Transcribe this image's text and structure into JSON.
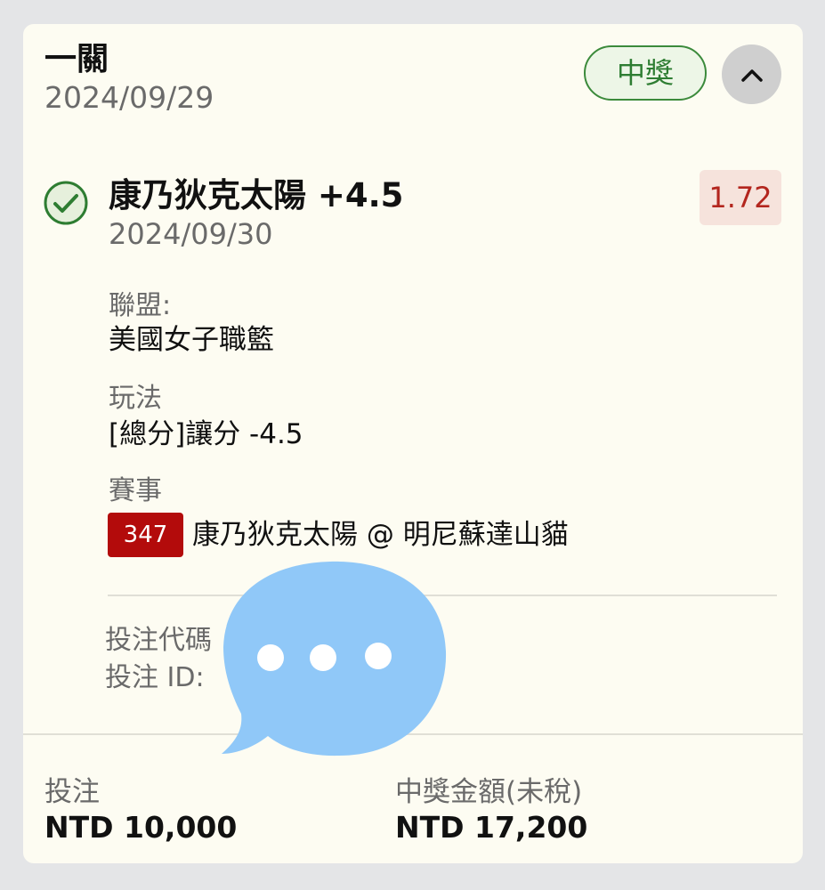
{
  "header": {
    "title": "一關",
    "date": "2024/09/29",
    "status_badge": "中獎"
  },
  "selection": {
    "pick": "康乃狄克太陽 +4.5",
    "date": "2024/09/30",
    "odds": "1.72",
    "status_icon": "check-circle-icon",
    "league_label": "聯盟:",
    "league_value": "美國女子職籃",
    "market_label": "玩法",
    "market_value": "[總分]讓分 -4.5",
    "event_label": "賽事",
    "event_number": "347",
    "event_value": "康乃狄克太陽 @ 明尼蘇達山貓"
  },
  "bet_info": {
    "code_label": "投注代碼",
    "id_label": "投注 ID:"
  },
  "footer": {
    "stake_label": "投注",
    "stake_value": "NTD 10,000",
    "payout_label": "中獎金額(未稅)",
    "payout_value": "NTD 17,200"
  },
  "colors": {
    "win_green": "#2e7d32",
    "odds_red": "#b3261e",
    "event_red": "#b30b0b",
    "bubble_blue": "#90c8f8"
  }
}
